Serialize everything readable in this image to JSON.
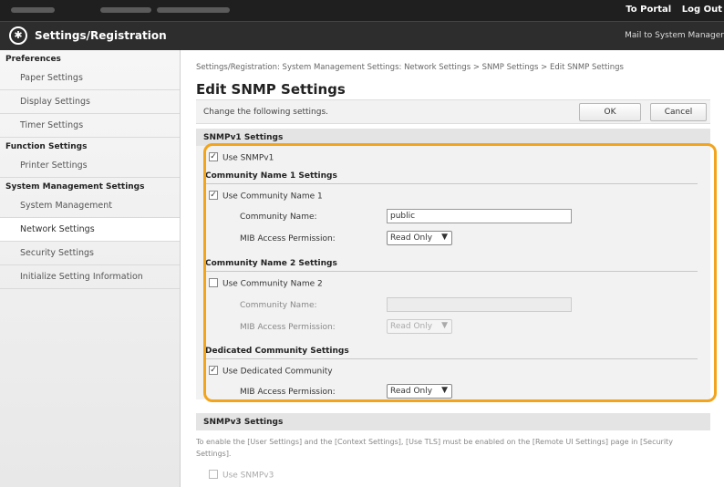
{
  "header": {
    "portal_link": "To Portal",
    "logout_link": "Log Out",
    "app_title": "Settings/Registration",
    "mail_link": "Mail to System Manager"
  },
  "sidebar": {
    "sections": [
      {
        "heading": "Preferences",
        "items": [
          "Paper Settings",
          "Display Settings",
          "Timer Settings"
        ]
      },
      {
        "heading": "Function Settings",
        "items": [
          "Printer Settings"
        ]
      },
      {
        "heading": "System Management Settings",
        "items": [
          "System Management",
          "Network Settings",
          "Security Settings",
          "Initialize Setting Information"
        ]
      }
    ],
    "active_item": "Network Settings"
  },
  "main": {
    "breadcrumb": "Settings/Registration: System Management Settings: Network Settings > SNMP Settings > Edit SNMP Settings",
    "page_title": "Edit SNMP Settings",
    "instruction": "Change the following settings.",
    "ok_label": "OK",
    "cancel_label": "Cancel",
    "snmpv1": {
      "section_title": "SNMPv1 Settings",
      "use_snmpv1_label": "Use SNMPv1",
      "use_snmpv1_checked": true,
      "community1": {
        "heading": "Community Name 1 Settings",
        "use_label": "Use Community Name 1",
        "use_checked": true,
        "name_label": "Community Name:",
        "name_value": "public",
        "mib_label": "MIB Access Permission:",
        "mib_value": "Read Only"
      },
      "community2": {
        "heading": "Community Name 2 Settings",
        "use_label": "Use Community Name 2",
        "use_checked": false,
        "name_label": "Community Name:",
        "name_value": "",
        "mib_label": "MIB Access Permission:",
        "mib_value": "Read Only"
      },
      "dedicated": {
        "heading": "Dedicated Community Settings",
        "use_label": "Use Dedicated Community",
        "use_checked": true,
        "mib_label": "MIB Access Permission:",
        "mib_value": "Read Only"
      }
    },
    "snmpv3": {
      "section_title": "SNMPv3 Settings",
      "note": "To enable the [User Settings] and the [Context Settings], [Use TLS] must be enabled on the [Remote UI Settings] page in [Security Settings].",
      "use_snmpv3_label": "Use SNMPv3"
    }
  },
  "colors": {
    "highlight": "#f2a41c",
    "topbar": "#1f1f1f"
  }
}
